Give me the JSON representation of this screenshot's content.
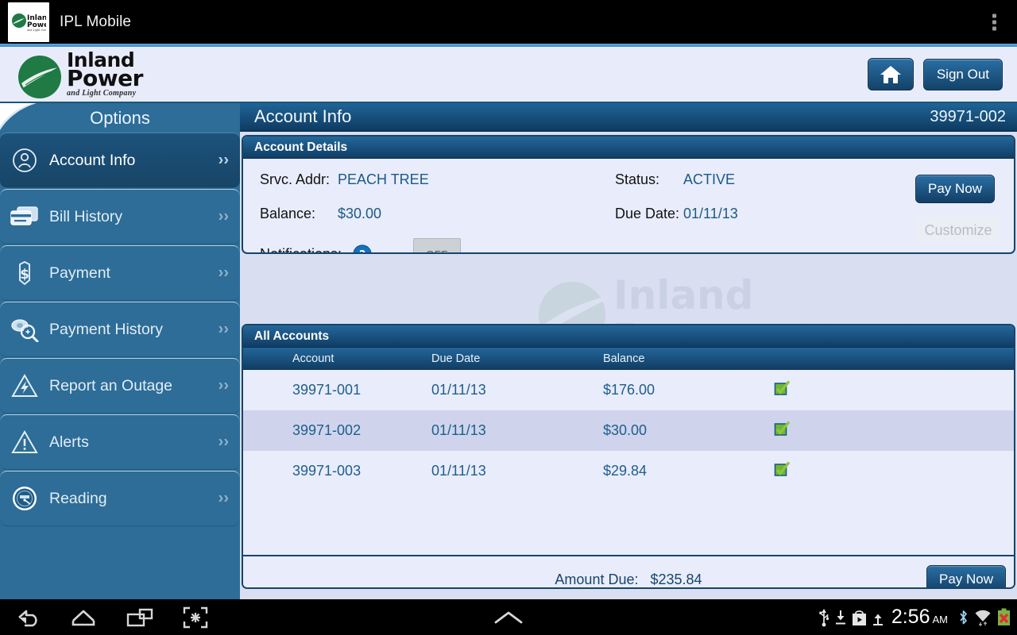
{
  "android": {
    "app_title": "IPL Mobile",
    "overflow_icon": "overflow-menu-icon",
    "nav": {
      "back": "back-icon",
      "home": "home-icon",
      "recents": "recents-icon",
      "screenshot": "screenshot-icon",
      "expand": "expand-up-icon"
    },
    "status": {
      "usb": "usb-icon",
      "download": "download-icon",
      "play_store": "play-store-icon",
      "upload": "upload-icon",
      "time": "2:56",
      "ampm": "AM",
      "bluetooth": "bluetooth-icon",
      "wifi": "wifi-icon",
      "battery": "battery-error-icon"
    }
  },
  "brand": {
    "line1": "Inland",
    "line2": "Power",
    "line3": "and Light Company",
    "mark": "inland-power-logo"
  },
  "header": {
    "home_button": "home-icon",
    "sign_out_label": "Sign Out"
  },
  "sidebar": {
    "title": "Options",
    "items": [
      {
        "label": "Account Info",
        "icon": "user-circle-icon",
        "selected": true
      },
      {
        "label": "Bill History",
        "icon": "credit-card-icon",
        "selected": false
      },
      {
        "label": "Payment",
        "icon": "dollar-icon",
        "selected": false
      },
      {
        "label": "Payment History",
        "icon": "money-search-icon",
        "selected": false
      },
      {
        "label": "Report an Outage",
        "icon": "outage-bolt-icon",
        "selected": false
      },
      {
        "label": "Alerts",
        "icon": "warning-icon",
        "selected": false
      },
      {
        "label": "Reading",
        "icon": "meter-icon",
        "selected": false
      }
    ],
    "chevron": "chevron-right-icon"
  },
  "page": {
    "title": "Account Info",
    "account_number": "39971-002",
    "watermark": "inland-power-watermark"
  },
  "account_details": {
    "card_title": "Account Details",
    "srvc_addr_label": "Srvc. Addr:",
    "srvc_addr_value": "PEACH TREE",
    "balance_label": "Balance:",
    "balance_value": "$30.00",
    "status_label": "Status:",
    "status_value": "ACTIVE",
    "due_date_label": "Due Date:",
    "due_date_value": "01/11/13",
    "notifications_label": "Notifications:",
    "help_icon": "help-icon",
    "toggle_value": "OFF",
    "pay_now_label": "Pay Now",
    "customize_label": "Customize"
  },
  "all_accounts": {
    "card_title": "All Accounts",
    "columns": [
      "Account",
      "Due Date",
      "Balance"
    ],
    "rows": [
      {
        "account": "39971-001",
        "due_date": "01/11/13",
        "balance": "$176.00",
        "checked": true
      },
      {
        "account": "39971-002",
        "due_date": "01/11/13",
        "balance": "$30.00",
        "checked": true
      },
      {
        "account": "39971-003",
        "due_date": "01/11/13",
        "balance": "$29.84",
        "checked": true
      }
    ],
    "check_icon": "green-checkbox-icon",
    "amount_due_label": "Amount Due:",
    "amount_due_value": "$235.84",
    "pay_now_label": "Pay Now"
  },
  "colors": {
    "brand_green": "#1f7a43",
    "header_blue": "#134269",
    "sidebar_blue": "#2d6d98",
    "panel_bg": "#e9ecfb",
    "value_text": "#1b5a85",
    "check_green": "#7ac143",
    "row_alt": "#cfd4ec"
  }
}
